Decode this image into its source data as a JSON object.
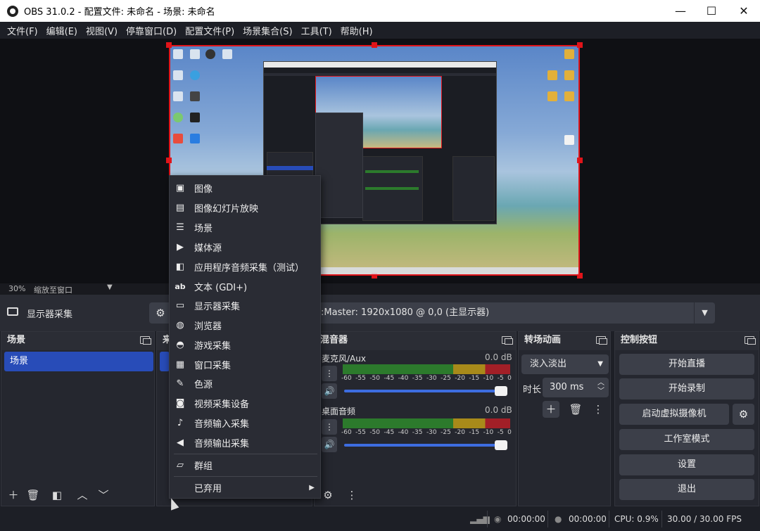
{
  "window": {
    "title": "OBS 31.0.2 - 配置文件: 未命名 - 场景: 未命名",
    "minimize": "—",
    "maximize": "☐",
    "close": "✕"
  },
  "menu": [
    "文件(F)",
    "编辑(E)",
    "视图(V)",
    "停靠窗口(D)",
    "配置文件(P)",
    "场景集合(S)",
    "工具(T)",
    "帮助(H)"
  ],
  "preview": {
    "zoom": "30%",
    "scale_mode": "缩放至窗口",
    "dropdown_arrow": "▼"
  },
  "source_toolbar": {
    "source_name": "显示器采集",
    "gear": "⚙",
    "display_value": ":Master: 1920x1080 @ 0,0 (主显示器)",
    "dropdown": "▼"
  },
  "scenes": {
    "header": "场景",
    "items": [
      "场景"
    ]
  },
  "sources_header_fragment": "来",
  "context_menu": {
    "items": [
      {
        "icon": "image-icon",
        "glyph": "▣",
        "label": "图像"
      },
      {
        "icon": "slideshow-icon",
        "glyph": "▤",
        "label": "图像幻灯片放映"
      },
      {
        "icon": "scene-list-icon",
        "glyph": "☰",
        "label": "场景"
      },
      {
        "icon": "play-icon",
        "glyph": "▶",
        "label": "媒体源"
      },
      {
        "icon": "app-audio-icon",
        "glyph": "◧",
        "label": "应用程序音频采集（测试）"
      },
      {
        "icon": "text-icon",
        "glyph": "ab",
        "label": "文本 (GDI+)"
      },
      {
        "icon": "monitor-icon",
        "glyph": "▭",
        "label": "显示器采集"
      },
      {
        "icon": "globe-icon",
        "glyph": "◍",
        "label": "浏览器"
      },
      {
        "icon": "gamepad-icon",
        "glyph": "◓",
        "label": "游戏采集"
      },
      {
        "icon": "window-icon",
        "glyph": "▦",
        "label": "窗口采集"
      },
      {
        "icon": "brush-icon",
        "glyph": "✎",
        "label": "色源"
      },
      {
        "icon": "camera-icon",
        "glyph": "◙",
        "label": "视频采集设备"
      },
      {
        "icon": "microphone-icon",
        "glyph": "♪",
        "label": "音频输入采集"
      },
      {
        "icon": "speaker-icon",
        "glyph": "◀",
        "label": "音频输出采集"
      }
    ],
    "group": {
      "icon": "folder-icon",
      "glyph": "▱",
      "label": "群组"
    },
    "deprecated": {
      "label": "已弃用",
      "arrow": "▶"
    }
  },
  "mixer": {
    "header": "混音器",
    "channels": [
      {
        "name": "麦克风/Aux",
        "db": "0.0 dB"
      },
      {
        "name": "桌面音频",
        "db": "0.0 dB"
      }
    ],
    "ticks": [
      "-60",
      "-55",
      "-50",
      "-45",
      "-40",
      "-35",
      "-30",
      "-25",
      "-20",
      "-15",
      "-10",
      "-5",
      "0"
    ]
  },
  "transitions": {
    "header": "转场动画",
    "type": "淡入淡出",
    "duration_label": "时长",
    "duration_value": "300 ms"
  },
  "controls": {
    "header": "控制按钮",
    "start_stream": "开始直播",
    "start_record": "开始录制",
    "virtual_cam": "启动虚拟摄像机",
    "studio_mode": "工作室模式",
    "settings": "设置",
    "exit": "退出"
  },
  "status": {
    "stream_time": "00:00:00",
    "record_time": "00:00:00",
    "cpu": "CPU: 0.9%",
    "fps": "30.00 / 30.00 FPS"
  }
}
